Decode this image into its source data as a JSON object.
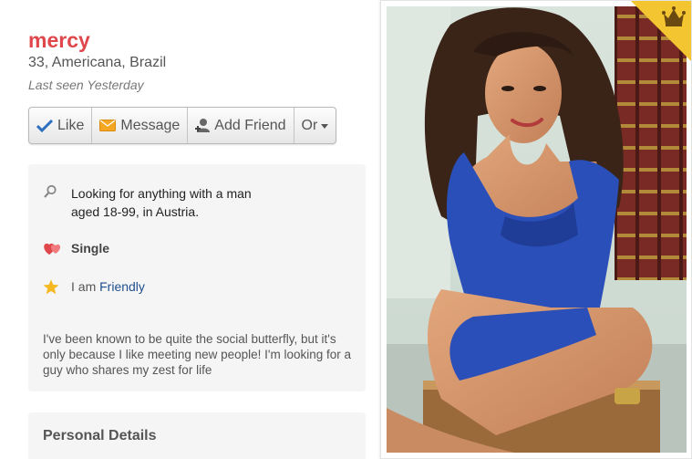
{
  "profile": {
    "name": "mercy",
    "location": "33, Americana, Brazil",
    "last_seen": "Last seen Yesterday"
  },
  "actions": {
    "like": "Like",
    "message": "Message",
    "add_friend": "Add Friend",
    "or": "Or"
  },
  "summary": {
    "looking_line1": "Looking for anything with a man",
    "looking_line2": "aged 18-99, in Austria.",
    "relationship": "Single",
    "personality_prefix": "I am",
    "personality": "Friendly",
    "bio": "I've been known to be quite the social butterfly, but it's only because I like meeting new people! I'm looking for a guy who shares my zest for life"
  },
  "details": {
    "title": "Personal Details"
  },
  "colors": {
    "name": "#e0474c",
    "link": "#1f4f8f",
    "premium": "#f2c531"
  }
}
